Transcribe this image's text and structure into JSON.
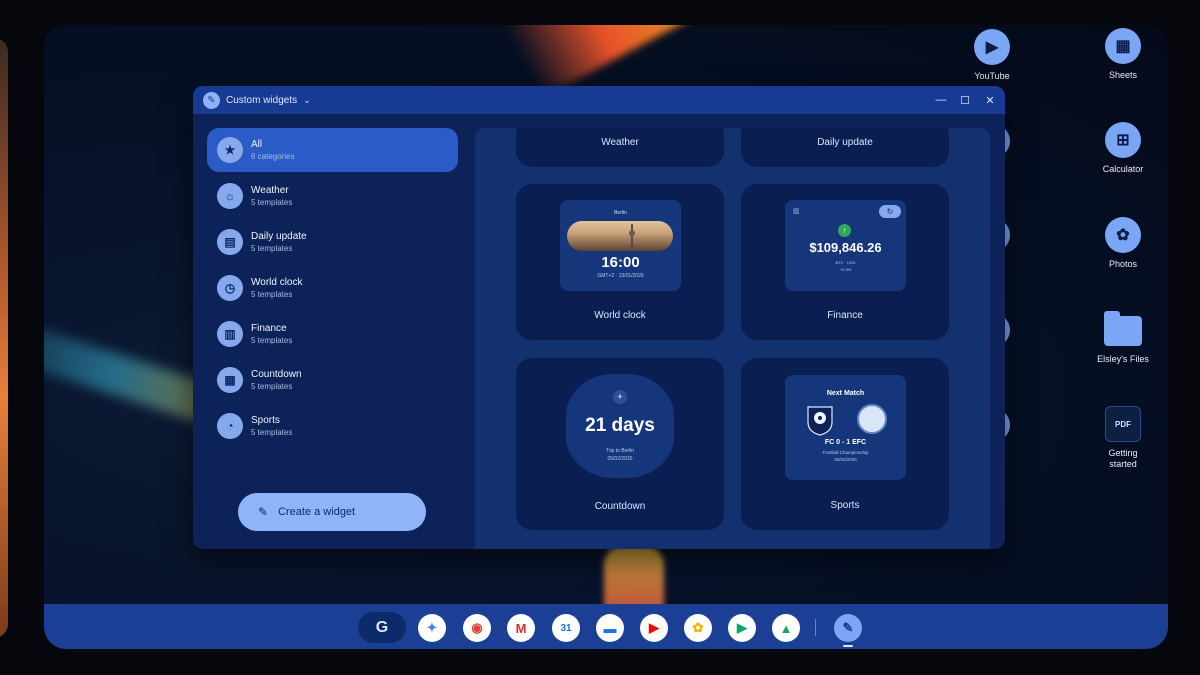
{
  "window": {
    "title": "Custom widgets",
    "controls": {
      "minimize": "—",
      "maximize": "☐",
      "close": "✕"
    }
  },
  "sidebar": {
    "categories": [
      {
        "name": "All",
        "sub": "6 categories",
        "icon": "star-icon",
        "glyph": "★",
        "active": true
      },
      {
        "name": "Weather",
        "sub": "5 templates",
        "icon": "weather-icon",
        "glyph": "☼",
        "active": false
      },
      {
        "name": "Daily update",
        "sub": "5 templates",
        "icon": "news-icon",
        "glyph": "▤",
        "active": false
      },
      {
        "name": "World clock",
        "sub": "5 templates",
        "icon": "clock-icon",
        "glyph": "◷",
        "active": false
      },
      {
        "name": "Finance",
        "sub": "5 templates",
        "icon": "bar-chart-icon",
        "glyph": "▥",
        "active": false
      },
      {
        "name": "Countdown",
        "sub": "5 templates",
        "icon": "calendar-icon",
        "glyph": "▦",
        "active": false
      },
      {
        "name": "Sports",
        "sub": "5 templates",
        "icon": "whistle-icon",
        "glyph": "◔",
        "active": false
      }
    ],
    "create_button": "Create a widget"
  },
  "cards": {
    "weather": {
      "label": "Weather"
    },
    "daily_update": {
      "label": "Daily update"
    },
    "world_clock": {
      "label": "World clock",
      "city": "Berlin",
      "time": "16:00",
      "date": "GMT+2 · 13/01/2026"
    },
    "finance": {
      "label": "Finance",
      "value": "$109,846.26",
      "ticker": "BTC · USD",
      "change": "+0.3%"
    },
    "countdown": {
      "label": "Countdown",
      "days": "21 days",
      "event": "Trip to Berlin",
      "date": "05/02/2026"
    },
    "sports": {
      "label": "Sports",
      "title": "Next Match",
      "score": "FC 0 - 1 EFC",
      "league": "Football Championship",
      "date": "30/02/2026"
    }
  },
  "desktop_icons": [
    {
      "label": "YouTube",
      "icon": "youtube-icon"
    },
    {
      "label": "Sheets",
      "icon": "sheets-icon"
    },
    {
      "label": "Calculator",
      "icon": "calculator-icon"
    },
    {
      "label": "Photos",
      "icon": "photos-icon"
    },
    {
      "label": "Elsley's Files",
      "icon": "folder-icon"
    },
    {
      "label": "Getting started",
      "icon": "pdf-icon",
      "badge": "PDF"
    }
  ],
  "shelf": {
    "launcher": "G",
    "apps": [
      {
        "icon": "gemini-icon",
        "glyph": "✦",
        "color": "#4a7ae8"
      },
      {
        "icon": "chrome-icon",
        "glyph": "◉",
        "color": "#dd4433"
      },
      {
        "icon": "gmail-icon",
        "glyph": "M",
        "color": "#d93025"
      },
      {
        "icon": "calendar-icon",
        "glyph": "31",
        "color": "#1a73e8"
      },
      {
        "icon": "files-icon",
        "glyph": "▬",
        "color": "#1a73e8"
      },
      {
        "icon": "youtube-icon",
        "glyph": "▶",
        "color": "#ff0000"
      },
      {
        "icon": "photos-icon",
        "glyph": "✿",
        "color": "#f4b400"
      },
      {
        "icon": "play-store-icon",
        "glyph": "▶",
        "color": "#00a86b"
      },
      {
        "icon": "drive-icon",
        "glyph": "▲",
        "color": "#1fa463"
      }
    ],
    "widgets_app_glyph": "✎"
  }
}
